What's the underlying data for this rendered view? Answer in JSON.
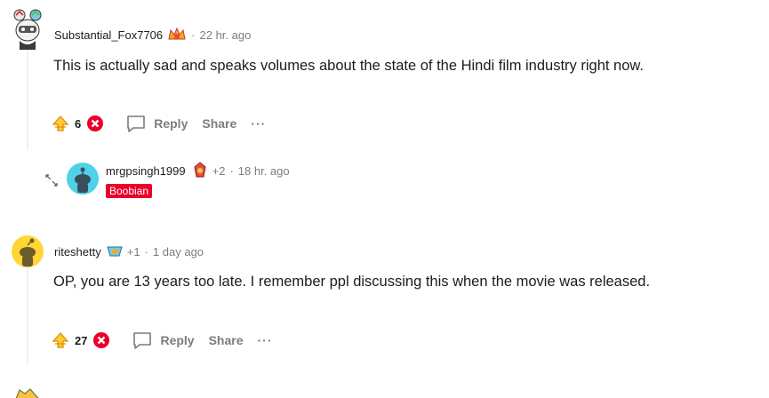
{
  "comments": [
    {
      "username": "Substantial_Fox7706",
      "separator": "·",
      "time": "22 hr. ago",
      "body": "This is actually sad and speaks volumes about the state of the Hindi film industry right now.",
      "votes": "6",
      "reply": "Reply",
      "share": "Share",
      "more": "···"
    },
    {
      "username": "mrgpsingh1999",
      "extra": "+2",
      "separator": "·",
      "time": "18 hr. ago",
      "flair": "Boobian"
    },
    {
      "username": "riteshetty",
      "extra": "+1",
      "separator": "·",
      "time": "1 day ago",
      "body": "OP, you are 13 years too late. I remember ppl discussing this when the movie was released.",
      "votes": "27",
      "reply": "Reply",
      "share": "Share",
      "more": "···"
    }
  ],
  "colors": {
    "flair_bg": "#ea0027",
    "upvote": "#ffb000",
    "downvote": "#ea0027",
    "muted": "#7c7c7c"
  }
}
